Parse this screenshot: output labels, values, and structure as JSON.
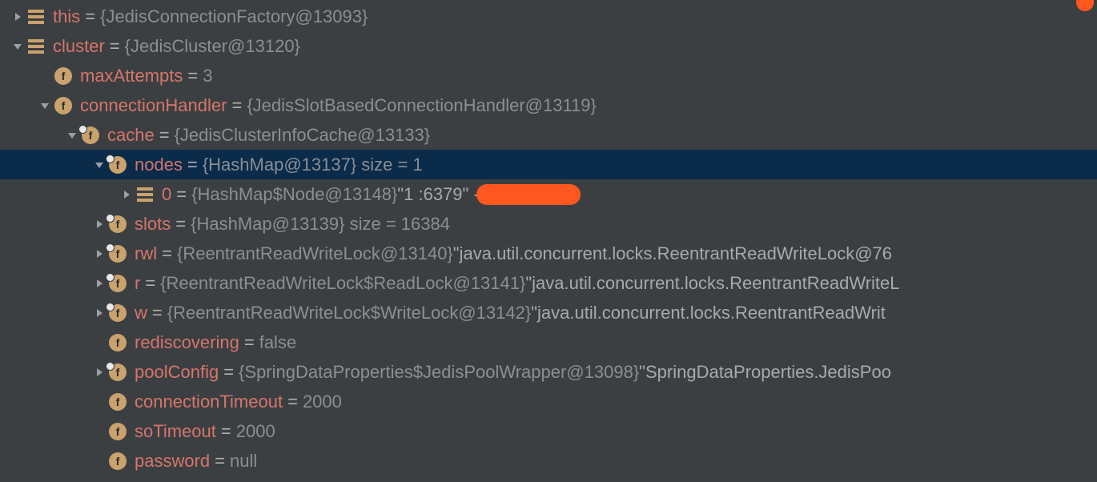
{
  "rows": [
    {
      "indent": 0,
      "arrow": "right",
      "icon": "bars",
      "name": "this",
      "eq": " = ",
      "val": "{JedisConnectionFactory@13093}"
    },
    {
      "indent": 0,
      "arrow": "down",
      "icon": "bars",
      "name": "cluster",
      "eq": " = ",
      "val": "{JedisCluster@13120}"
    },
    {
      "indent": 34,
      "arrow": "none",
      "icon": "f",
      "name": "maxAttempts",
      "eq": " = ",
      "val": "3"
    },
    {
      "indent": 34,
      "arrow": "down",
      "icon": "f",
      "name": "connectionHandler",
      "eq": " = ",
      "val": "{JedisSlotBasedConnectionHandler@13119}"
    },
    {
      "indent": 68,
      "arrow": "down",
      "icon": "fbadge",
      "name": "cache",
      "eq": " = ",
      "val": "{JedisClusterInfoCache@13133}"
    },
    {
      "indent": 102,
      "arrow": "down",
      "icon": "fbadge",
      "name": "nodes",
      "eq": " = ",
      "val": "{HashMap@13137}  size = 1",
      "selected": true
    },
    {
      "indent": 136,
      "arrow": "right",
      "icon": "bars",
      "name": "0",
      "eq": " = ",
      "val": "{HashMap$Node@13148} ",
      "str": "\"1                      :6379\" ->",
      "redact": true
    },
    {
      "indent": 102,
      "arrow": "right",
      "icon": "fbadge",
      "name": "slots",
      "eq": " = ",
      "val": "{HashMap@13139}  size = 16384"
    },
    {
      "indent": 102,
      "arrow": "right",
      "icon": "fbadge",
      "name": "rwl",
      "eq": " = ",
      "val": "{ReentrantReadWriteLock@13140} ",
      "str": "\"java.util.concurrent.locks.ReentrantReadWriteLock@76"
    },
    {
      "indent": 102,
      "arrow": "right",
      "icon": "fbadge",
      "name": "r",
      "eq": " = ",
      "val": "{ReentrantReadWriteLock$ReadLock@13141} ",
      "str": "\"java.util.concurrent.locks.ReentrantReadWriteL"
    },
    {
      "indent": 102,
      "arrow": "right",
      "icon": "fbadge",
      "name": "w",
      "eq": " = ",
      "val": "{ReentrantReadWriteLock$WriteLock@13142} ",
      "str": "\"java.util.concurrent.locks.ReentrantReadWrit"
    },
    {
      "indent": 102,
      "arrow": "none",
      "icon": "f",
      "name": "rediscovering",
      "eq": " = ",
      "val": "false"
    },
    {
      "indent": 102,
      "arrow": "right",
      "icon": "fbadge",
      "name": "poolConfig",
      "eq": " = ",
      "val": "{SpringDataProperties$JedisPoolWrapper@13098} ",
      "str": "\"SpringDataProperties.JedisPoo"
    },
    {
      "indent": 102,
      "arrow": "none",
      "icon": "f",
      "name": "connectionTimeout",
      "eq": " = ",
      "val": "2000"
    },
    {
      "indent": 102,
      "arrow": "none",
      "icon": "f",
      "name": "soTimeout",
      "eq": " = ",
      "val": "2000"
    },
    {
      "indent": 102,
      "arrow": "none",
      "icon": "f",
      "name": "password",
      "eq": " = ",
      "val": "null"
    }
  ]
}
